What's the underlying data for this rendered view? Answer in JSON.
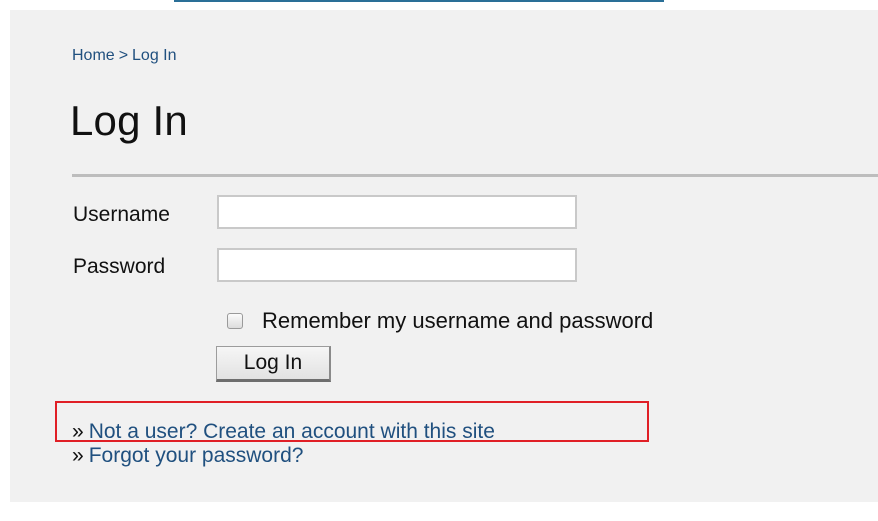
{
  "breadcrumb": {
    "home": "Home",
    "separator": ">",
    "current": "Log In"
  },
  "page": {
    "title": "Log In"
  },
  "form": {
    "username_label": "Username",
    "username_value": "",
    "password_label": "Password",
    "password_value": "",
    "remember_label": "Remember my username and password",
    "remember_checked": false,
    "submit_label": "Log In"
  },
  "links": {
    "bullet": "»",
    "create_account": "Not a user? Create an account with this site",
    "forgot_password": "Forgot your password?"
  },
  "colors": {
    "link": "#20507f",
    "highlight": "#e01f26",
    "panel_background": "#f1f1f1"
  }
}
